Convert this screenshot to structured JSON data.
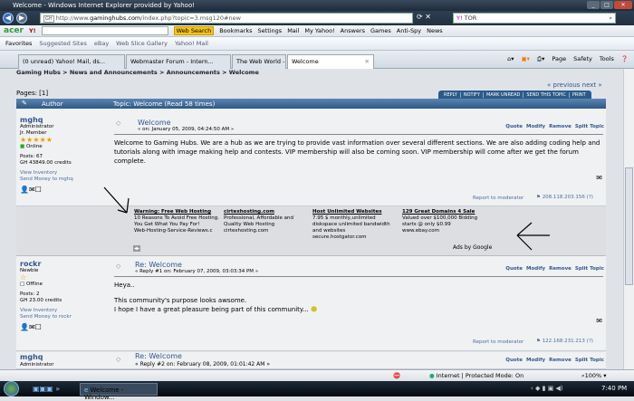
{
  "window": {
    "title": "Welcome - Windows Internet Explorer provided by Yahoo!"
  },
  "address": {
    "favicon": "GH",
    "url_prefix": "http://www.",
    "url_domain": "gaminghubs.com",
    "url_path": "/index.php?topic=3.msg120#new",
    "search_value": "TOR"
  },
  "yahoo_toolbar": {
    "items": [
      "acer",
      "Y!",
      "Web Search",
      "Bookmarks",
      "Settings",
      "Mail",
      "My Yahoo!",
      "Answers",
      "Games",
      "Anti-Spy",
      "News"
    ]
  },
  "favorites_bar": {
    "items": [
      "Favorites",
      "Suggested Sites",
      "eBay",
      "Web Slice Gallery",
      "Yahoo! Mail"
    ]
  },
  "tabs": [
    "(0 unread) Yahoo! Mail, ds...",
    "Webmaster Forum - Intern...",
    "The Web World - A Uniqu...",
    "Welcome"
  ],
  "command_bar": [
    "Page",
    "Safety",
    "Tools"
  ],
  "forum": {
    "breadcrumb": "Gaming Hubs > News and Announcements > Announcements > Welcome",
    "prev_next": "« previous next »",
    "pages": "Pages: [1]",
    "buttons": [
      "REPLY",
      "NOTIFY",
      "MARK UNREAD",
      "SEND THIS TOPIC",
      "PRINT"
    ],
    "header_author": "Author",
    "header_topic": "Topic: Welcome  (Read 58 times)",
    "actions": [
      "Quote",
      "Modify",
      "Remove",
      "Split Topic"
    ],
    "report": "Report to moderator",
    "posts": [
      {
        "user": "mghq",
        "role": "Administrator",
        "rank": "Jr. Member",
        "stars": 5,
        "status": "Online",
        "posts": "Posts: 67",
        "credits": "GH 43849.00 credits",
        "inventory": "View Inventory",
        "send_money": "Send Money to mghq",
        "title": "Welcome",
        "date": "« on: January 05, 2009, 04:24:50 AM »",
        "body": [
          "Welcome to Gaming Hubs. We are a hub as we are trying to provide vast information over several different sections. We are also adding coding help and tutorials along with image making help and contests. VIP membership will also be coming soon. VIP membership will come after we get the forum complete."
        ],
        "ip": "208.118.203.156 (?)"
      },
      {
        "user": "rockr",
        "role": "Newbie",
        "stars": 1,
        "status": "Offline",
        "posts": "Posts: 2",
        "credits": "GH 23.00 credits",
        "inventory": "View Inventory",
        "send_money": "Send Money to rockr",
        "title": "Re: Welcome",
        "date": "« Reply #1 on: February 07, 2009, 03:03:34 PM »",
        "body": [
          "Heya..",
          "This community's purpose looks awsome.",
          "I hope I have a great pleasure being part of this community..."
        ],
        "ip": "122.168.231.213 (?)"
      },
      {
        "user": "mghq",
        "role": "Administrator",
        "title": "Re: Welcome",
        "date": "« Reply #2 on: February 08, 2009, 01:01:42 AM »"
      }
    ],
    "ads": [
      {
        "title": "Warning: Free Web Hosting",
        "text": "10 Reasons To Avoid Free Hosting. You Get What You Pay For!",
        "url": "Web-Hosting-Service-Reviews.c"
      },
      {
        "title": "cirtexhosting.com",
        "text": "Professional, Affordable and Quality Web Hosting",
        "url": "cirtexhosting.com"
      },
      {
        "title": "Host Unlimited Websites",
        "text": "7.95 $ monthly,unlimited diskspace unlimited bandwidth and websites",
        "url": "secure.hostgator.com"
      },
      {
        "title": "129 Great Domains 4 Sale",
        "text": "Valued over $100,000 Bidding starts @ only $0.99",
        "url": "www.ebay.com"
      }
    ],
    "ads_by": "Ads by Google"
  },
  "status": {
    "zone": "Internet | Protected Mode: On",
    "zoom": "100%"
  },
  "taskbar": {
    "window": "Welcome - Window...",
    "clock": "7:40 PM"
  }
}
